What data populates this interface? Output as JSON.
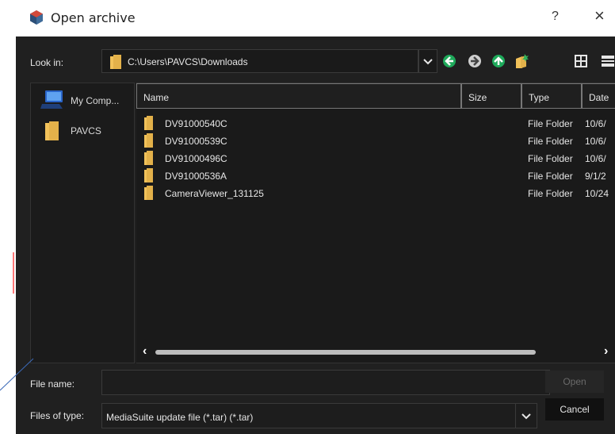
{
  "title": "Open archive",
  "help_label": "?",
  "close_label": "×",
  "lookin": {
    "label": "Look in:",
    "path": "C:\\Users\\PAVCS\\Downloads"
  },
  "places": [
    {
      "label": "My Comp...",
      "icon": "computer-icon"
    },
    {
      "label": "PAVCS",
      "icon": "folder-icon"
    }
  ],
  "columns": [
    "Name",
    "Size",
    "Type",
    "Date"
  ],
  "files": [
    {
      "name": "DV91000540C",
      "type": "File Folder",
      "date": "10/6/"
    },
    {
      "name": "DV91000539C",
      "type": "File Folder",
      "date": "10/6/"
    },
    {
      "name": "DV91000496C",
      "type": "File Folder",
      "date": "10/6/"
    },
    {
      "name": "DV91000536A",
      "type": "File Folder",
      "date": "9/1/2"
    },
    {
      "name": "CameraViewer_131125",
      "type": "File Folder",
      "date": "10/24"
    }
  ],
  "filename": {
    "label": "File name:",
    "value": ""
  },
  "filetype": {
    "label": "Files of type:",
    "value": "MediaSuite update file (*.tar) (*.tar)"
  },
  "buttons": {
    "open": "Open",
    "cancel": "Cancel"
  },
  "colors": {
    "background": "#202020",
    "accent_green": "#16a34a",
    "folder": "#f2c25a"
  }
}
